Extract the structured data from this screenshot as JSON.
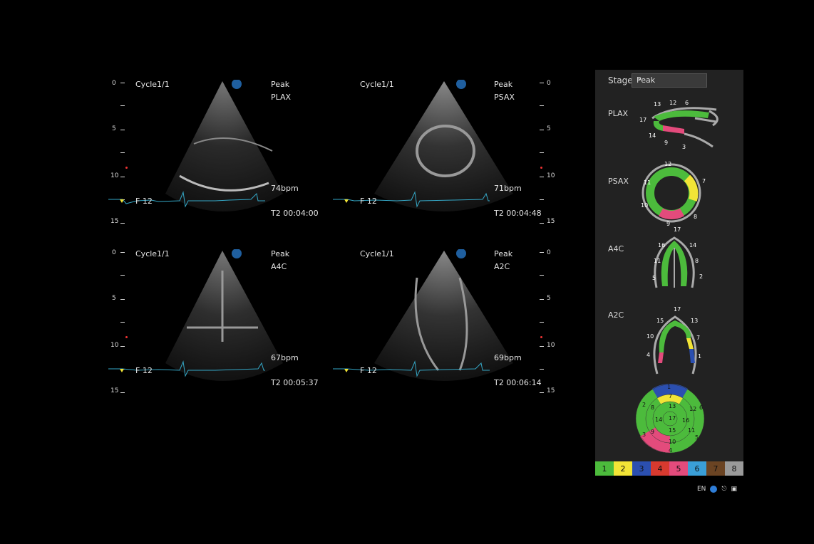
{
  "images": [
    {
      "cycle": "Cycle1/1",
      "stage": "Peak",
      "view": "PLAX",
      "hr": "74bpm",
      "frame": "F 12",
      "time": "T2 00:04:00",
      "scale": [
        "0",
        "5",
        "10",
        "15"
      ]
    },
    {
      "cycle": "Cycle1/1",
      "stage": "Peak",
      "view": "PSAX",
      "hr": "71bpm",
      "frame": "F 12",
      "time": "T2 00:04:48",
      "scale": [
        "0",
        "5",
        "10",
        "15"
      ]
    },
    {
      "cycle": "Cycle1/1",
      "stage": "Peak",
      "view": "A4C",
      "hr": "67bpm",
      "frame": "F 12",
      "time": "T2 00:05:37",
      "scale": [
        "0",
        "5",
        "10",
        "15"
      ]
    },
    {
      "cycle": "Cycle1/1",
      "stage": "Peak",
      "view": "A2C",
      "hr": "69bpm",
      "frame": "F 12",
      "time": "T2 00:06:14",
      "scale": [
        "0",
        "5",
        "10",
        "15"
      ]
    }
  ],
  "panel": {
    "stage_label": "Stage",
    "stage_value": "Peak",
    "views": [
      "PLAX",
      "PSAX",
      "A4C",
      "A2C"
    ],
    "plax_segments": [
      "13",
      "12",
      "6",
      "17",
      "14",
      "9",
      "3"
    ],
    "psax_segments": [
      "12",
      "11",
      "7",
      "10",
      "8",
      "9"
    ],
    "a4c_segments": [
      "17",
      "16",
      "14",
      "11",
      "8",
      "5",
      "2"
    ],
    "a2c_segments": [
      "17",
      "15",
      "13",
      "10",
      "7",
      "4",
      "1"
    ],
    "bullseye_segments": [
      "1",
      "7",
      "2",
      "8",
      "13",
      "14",
      "17",
      "16",
      "12",
      "6",
      "3",
      "9",
      "15",
      "11",
      "10",
      "4",
      "5"
    ]
  },
  "legend": [
    {
      "label": "1",
      "color": "#4cbb3c"
    },
    {
      "label": "2",
      "color": "#f2e436"
    },
    {
      "label": "3",
      "color": "#2b4fb0"
    },
    {
      "label": "4",
      "color": "#d83a2f"
    },
    {
      "label": "5",
      "color": "#e34b7c"
    },
    {
      "label": "6",
      "color": "#3a9fd8"
    },
    {
      "label": "7",
      "color": "#6b4423"
    },
    {
      "label": "8",
      "color": "#9a9a9a"
    }
  ],
  "status": {
    "lang": "EN",
    "icons": [
      "globe-icon",
      "usb-icon",
      "network-icon"
    ]
  }
}
